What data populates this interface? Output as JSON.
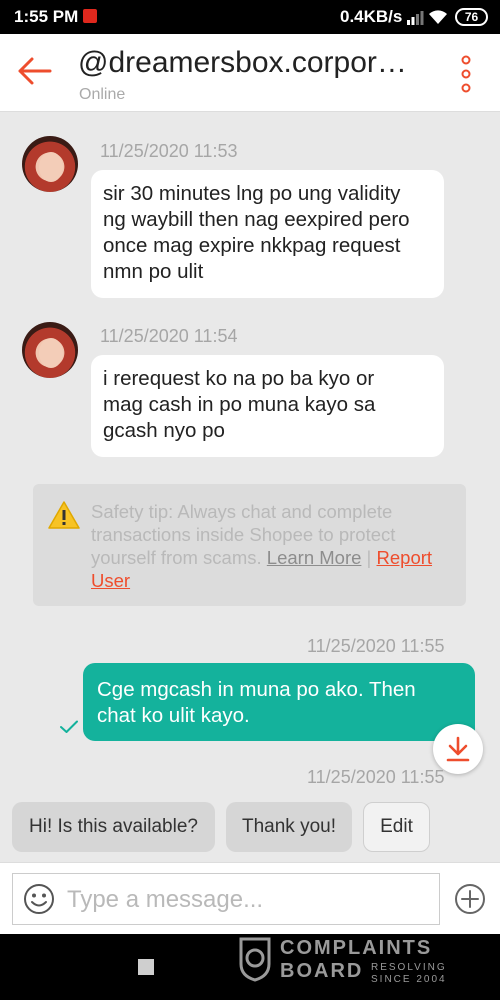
{
  "status_bar": {
    "time": "1:55 PM",
    "network_speed": "0.4KB/s",
    "battery": "76",
    "icons": [
      "notification-icon",
      "signal-icon",
      "wifi-icon",
      "battery-icon"
    ]
  },
  "header": {
    "title": "@dreamersbox.corporation",
    "subtitle": "Online",
    "back_icon": "back-arrow-icon",
    "menu_icon": "more-vertical-icon"
  },
  "messages": [
    {
      "direction": "incoming",
      "timestamp": "11/25/2020 11:53",
      "lines": [
        "sir 30 minutes lng po ung validity",
        "ng waybill then nag eexpired pero",
        "once mag expire nkkpag request",
        "nmn po ulit"
      ]
    },
    {
      "direction": "incoming",
      "timestamp": "11/25/2020 11:54",
      "lines": [
        "i rerequest ko na po ba kyo or",
        "mag cash in po muna kayo sa",
        "gcash nyo po"
      ]
    },
    {
      "direction": "outgoing",
      "timestamp": "11/25/2020 11:55",
      "lines": [
        "Cge mgcash in muna po ako. Then",
        "chat ko ulit kayo."
      ]
    }
  ],
  "trailing_timestamp": "11/25/2020 11:55",
  "safety_tip": {
    "text": "Safety tip: Always chat and complete transactions inside Shopee to protect yourself from scams.",
    "learn_more": "Learn More",
    "separator": "|",
    "report_line1": "Report",
    "report_line2": "User"
  },
  "quick_replies": [
    "Hi! Is this available?",
    "Thank you!",
    "Edit"
  ],
  "input": {
    "placeholder": "Type a message..."
  },
  "watermark": {
    "line1": "COMPLAINTS",
    "line2": "BOARD",
    "small1": "RESOLVING",
    "small2": "SINCE 2004"
  },
  "colors": {
    "accent": "#ee4d2d",
    "outgoing_bubble": "#14b29c",
    "background": "#e9e9e9"
  }
}
